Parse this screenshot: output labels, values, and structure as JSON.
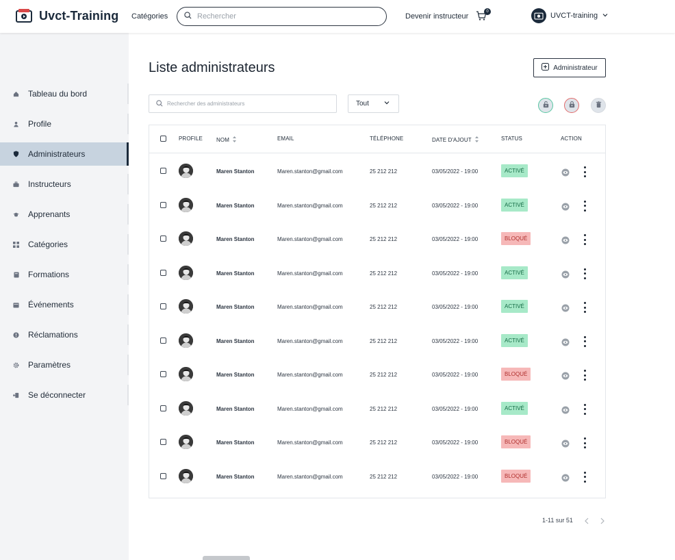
{
  "header": {
    "brand": "Uvct-Training",
    "categories_link": "Catégories",
    "search_placeholder": "Rechercher",
    "become_instructor": "Devenir instructeur",
    "cart_count": "0",
    "user_name": "UVCT-training"
  },
  "sidebar": {
    "items": [
      {
        "label": "Tableau du bord",
        "icon": "home-icon"
      },
      {
        "label": "Profile",
        "icon": "user-icon"
      },
      {
        "label": "Administrateurs",
        "icon": "shield-icon",
        "active": true
      },
      {
        "label": "Instructeurs",
        "icon": "briefcase-icon"
      },
      {
        "label": "Apprenants",
        "icon": "graduation-cap-icon"
      },
      {
        "label": "Catégories",
        "icon": "grid-icon"
      },
      {
        "label": "Formations",
        "icon": "book-icon"
      },
      {
        "label": "Événements",
        "icon": "calendar-icon"
      },
      {
        "label": "Réclamations",
        "icon": "alert-circle-icon"
      },
      {
        "label": "Paramètres",
        "icon": "gear-icon"
      },
      {
        "label": "Se déconnecter",
        "icon": "logout-icon"
      }
    ]
  },
  "main": {
    "title": "Liste administrateurs",
    "add_button": "Administrateur",
    "search_placeholder": "Rechercher des administrateurs",
    "filter_value": "Tout",
    "colors": {
      "active_bg": "#a7e9c8",
      "active_text": "#146b45",
      "blocked_bg": "#f6b8b8",
      "blocked_text": "#b0302e",
      "accent": "#1b2a3b"
    }
  },
  "table": {
    "headers": {
      "profile": "PROFILE",
      "name": "NOM",
      "email": "EMAIL",
      "phone": "TÉLÉPHONE",
      "date": "DATE D'AJOUT",
      "status": "STATUS",
      "action": "ACTION"
    },
    "rows": [
      {
        "name": "Maren Stanton",
        "email": "Maren.stanton@gmail.com",
        "phone": "25 212 212",
        "date": "03/05/2022 - 19:00",
        "status": "ACTIVÉ",
        "state": "ok"
      },
      {
        "name": "Maren Stanton",
        "email": "Maren.stanton@gmail.com",
        "phone": "25 212 212",
        "date": "03/05/2022 - 19:00",
        "status": "ACTIVÉ",
        "state": "ok"
      },
      {
        "name": "Maren Stanton",
        "email": "Maren.stanton@gmail.com",
        "phone": "25 212 212",
        "date": "03/05/2022 - 19:00",
        "status": "BLOQUÉ",
        "state": "ko"
      },
      {
        "name": "Maren Stanton",
        "email": "Maren.stanton@gmail.com",
        "phone": "25 212 212",
        "date": "03/05/2022 - 19:00",
        "status": "ACTIVÉ",
        "state": "ok"
      },
      {
        "name": "Maren Stanton",
        "email": "Maren.stanton@gmail.com",
        "phone": "25 212 212",
        "date": "03/05/2022 - 19:00",
        "status": "ACTIVÉ",
        "state": "ok"
      },
      {
        "name": "Maren Stanton",
        "email": "Maren.stanton@gmail.com",
        "phone": "25 212 212",
        "date": "03/05/2022 - 19:00",
        "status": "ACTIVÉ",
        "state": "ok"
      },
      {
        "name": "Maren Stanton",
        "email": "Maren.stanton@gmail.com",
        "phone": "25 212 212",
        "date": "03/05/2022 - 19:00",
        "status": "BLOQUÉ",
        "state": "ko"
      },
      {
        "name": "Maren Stanton",
        "email": "Maren.stanton@gmail.com",
        "phone": "25 212 212",
        "date": "03/05/2022 - 19:00",
        "status": "ACTIVÉ",
        "state": "ok"
      },
      {
        "name": "Maren Stanton",
        "email": "Maren.stanton@gmail.com",
        "phone": "25 212 212",
        "date": "03/05/2022 - 19:00",
        "status": "BLOQUÉ",
        "state": "ko"
      },
      {
        "name": "Maren Stanton",
        "email": "Maren.stanton@gmail.com",
        "phone": "25 212 212",
        "date": "03/05/2022 - 19:00",
        "status": "BLOQUÉ",
        "state": "ko"
      }
    ]
  },
  "pagination": {
    "text": "1-11 sur 51"
  }
}
